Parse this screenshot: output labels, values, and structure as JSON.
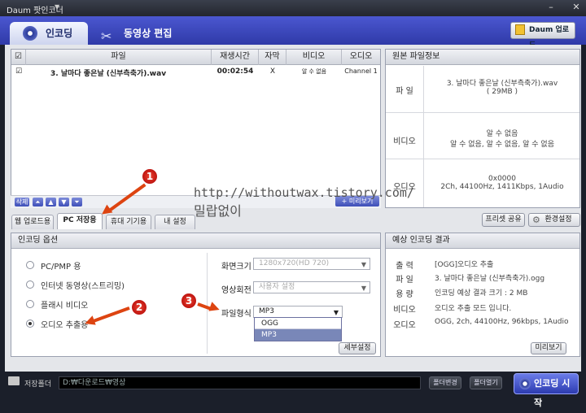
{
  "window": {
    "title": "Daum 팟인코더",
    "title_dropdown": "▼"
  },
  "tabs": {
    "encode": "인코딩",
    "edit": "동영상 편집"
  },
  "upload_button": "Daum 업로드",
  "file_table": {
    "headers": [
      "파일",
      "재생시간",
      "자막",
      "비디오",
      "오디오"
    ],
    "rows": [
      {
        "file": "3. 날마다 좋은날 (신부측축가).wav",
        "duration": "00:02:54",
        "subtitle": "X",
        "video": "알 수 없음",
        "audio": "Channel 1"
      }
    ]
  },
  "list_tools": {
    "delete": "삭제",
    "preview": "미리보기"
  },
  "source_info": {
    "title": "원본 파일정보",
    "file_label": "파 일",
    "file_value": "3. 날마다 좋은날 (신부측축가).wav\n( 29MB )",
    "video_label": "비디오",
    "video_value": "알 수 없음\n알 수 없음, 알 수 없음, 알 수 없음",
    "audio_label": "오디오",
    "audio_value": "0x0000\n2Ch, 44100Hz, 1411Kbps, 1Audio"
  },
  "subtabs": [
    "웹 업로드용",
    "PC 저장용",
    "휴대 기기용",
    "내 설정"
  ],
  "preset_share": "프리셋 공유",
  "env_settings": "환경설정",
  "encode_options": {
    "title": "인코딩 옵션",
    "radios": [
      "PC/PMP 용",
      "인터넷 동영상(스트리밍)",
      "플래시 비디오",
      "오디오 추출용"
    ],
    "selected": 3,
    "screen_size_label": "화면크기",
    "screen_size_value": "1280x720(HD 720)",
    "rotate_label": "영상회전",
    "rotate_value": "사용자 설정",
    "format_label": "파일형식",
    "format_value": "MP3",
    "format_options": [
      "OGG",
      "MP3"
    ],
    "detail_button": "세부설정"
  },
  "result": {
    "title": "예상 인코딩 결과",
    "rows": [
      {
        "label": "출 력",
        "value": "[OGG]오디오 추출"
      },
      {
        "label": "파 일",
        "value": "3. 날마다 좋은날 (신부측축가).ogg"
      },
      {
        "label": "용 량",
        "value": "인코딩 예상 결과 크기 : 2 MB"
      },
      {
        "label": "비디오",
        "value": "오디오 추출 모드 입니다."
      },
      {
        "label": "오디오",
        "value": "OGG, 2ch, 44100Hz, 96kbps, 1Audio"
      }
    ],
    "preview_button": "미리보기"
  },
  "bottom": {
    "save_folder_label": "저장폴더",
    "folder_path": "D:₩다운로드₩영상",
    "change_button": "폴더변경",
    "open_button": "폴더열기",
    "start_button": "인코딩 시작"
  },
  "annotations": {
    "watermark_url": "http://withoutwax.tistory.com/",
    "watermark_name": "밀랍없이",
    "badges": [
      "1",
      "2",
      "3"
    ]
  },
  "colors": {
    "accent": "#3a46c0",
    "arrow": "#d41a0a"
  }
}
